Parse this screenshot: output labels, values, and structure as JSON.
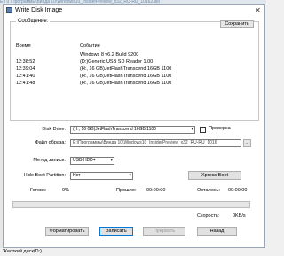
{
  "background_path": "E:\\ 0 \\Программы\\Виндa 10\\Windows10_InsiderPreview_x32_RU-RU_10162.iso",
  "window": {
    "title": "Write Disk Image",
    "close_glyph": "✕"
  },
  "messages": {
    "legend": "Сообщение:",
    "save_label": "Сохранить",
    "columns": {
      "time": "Время",
      "event": "Событие"
    },
    "rows": [
      {
        "time": "",
        "event": "Windows 8 v6.2 Build 9200"
      },
      {
        "time": "12:38:52",
        "event": "(D:)Generic USB SD Reader   1.00"
      },
      {
        "time": "12:39:04",
        "event": "(H:, 16 GB)JetFlashTranscend 16GB   1100"
      },
      {
        "time": "12:41:40",
        "event": "(H:, 16 GB)JetFlashTranscend 16GB   1100"
      },
      {
        "time": "12:41:48",
        "event": "(H:, 16 GB)JetFlashTranscend 16GB   1100"
      }
    ]
  },
  "form": {
    "disk_drive_label": "Disk Drive:",
    "disk_drive_value": "(H:, 16 GB)JetFlashTranscend 16GB   1100",
    "verify_label": "Проверка",
    "image_file_label": "Файл образа:",
    "image_file_value": "E:\\Программы\\Виндa 10\\Windows10_InsiderPreview_x32_RU-RU_1016",
    "browse_label": "...",
    "write_method_label": "Метод записи:",
    "write_method_value": "USB-HDD+",
    "hide_boot_label": "Hide Boot Partition:",
    "hide_boot_value": "Нет",
    "xpress_boot_label": "Xpress Boot",
    "arrow_glyph": "▾"
  },
  "stats": {
    "done_label": "Готово:",
    "done_value": "0%",
    "elapsed_label": "Прошло:",
    "elapsed_value": "00:00:00",
    "remaining_label": "Осталось:",
    "remaining_value": "00:00:00",
    "speed_label": "Скорость:",
    "speed_value": "0KB/s",
    "progress_fraction": 0
  },
  "buttons": {
    "format": "Форматировать",
    "write": "Записать",
    "abort": "Прервать",
    "back": "Назад"
  },
  "status_bar": {
    "text": "Жесткий диск(D:)"
  }
}
